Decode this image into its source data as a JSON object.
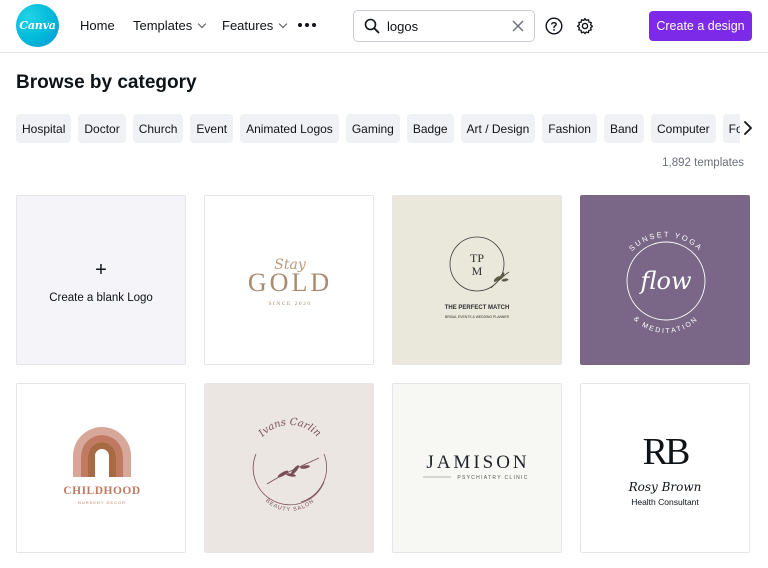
{
  "header": {
    "logo_text": "Canva",
    "nav": [
      {
        "label": "Home"
      },
      {
        "label": "Templates"
      },
      {
        "label": "Features"
      }
    ],
    "search": {
      "value": "logos",
      "placeholder": "Search"
    },
    "create_button": "Create a design"
  },
  "page_title": "Browse by category",
  "categories": [
    "Hospital",
    "Doctor",
    "Church",
    "Event",
    "Animated Logos",
    "Gaming",
    "Badge",
    "Art / Design",
    "Fashion",
    "Band",
    "Computer",
    "Food / Drink"
  ],
  "template_count": "1,892 templates",
  "blank_card": {
    "plus": "+",
    "label": "Create a blank Logo"
  },
  "templates": [
    {
      "line1": "Stay",
      "line2": "GOLD",
      "line3": "SINCE 2020"
    },
    {
      "monogram_top": "TP",
      "monogram_bottom": "M",
      "line1": "THE PERFECT MATCH",
      "line2": "BRIDAL EVENTS & WEDDING PLANNER"
    },
    {
      "arc_top": "SUNSET YOGA",
      "script": "flow",
      "arc_bottom": "& MEDITATION"
    },
    {
      "line1": "CHILDHOOD",
      "line2": "NURSERY DECOR"
    },
    {
      "script": "Ivans Carlin",
      "arc_bottom": "BEAUTY SALON"
    },
    {
      "line1": "JAMISON",
      "line2": "PSYCHIATRY CLINIC"
    },
    {
      "monogram": "RB",
      "script": "Rosy Brown",
      "line1": "Health Consultant"
    }
  ],
  "colors": {
    "accent": "#7d2ae8",
    "brand": "#00c4cc",
    "chip_bg": "#f0f1f5",
    "yoga_bg": "#7a6787",
    "match_bg": "#e9e8da",
    "salon_bg": "#ece6e3",
    "childhood_text": "#c07a62"
  }
}
